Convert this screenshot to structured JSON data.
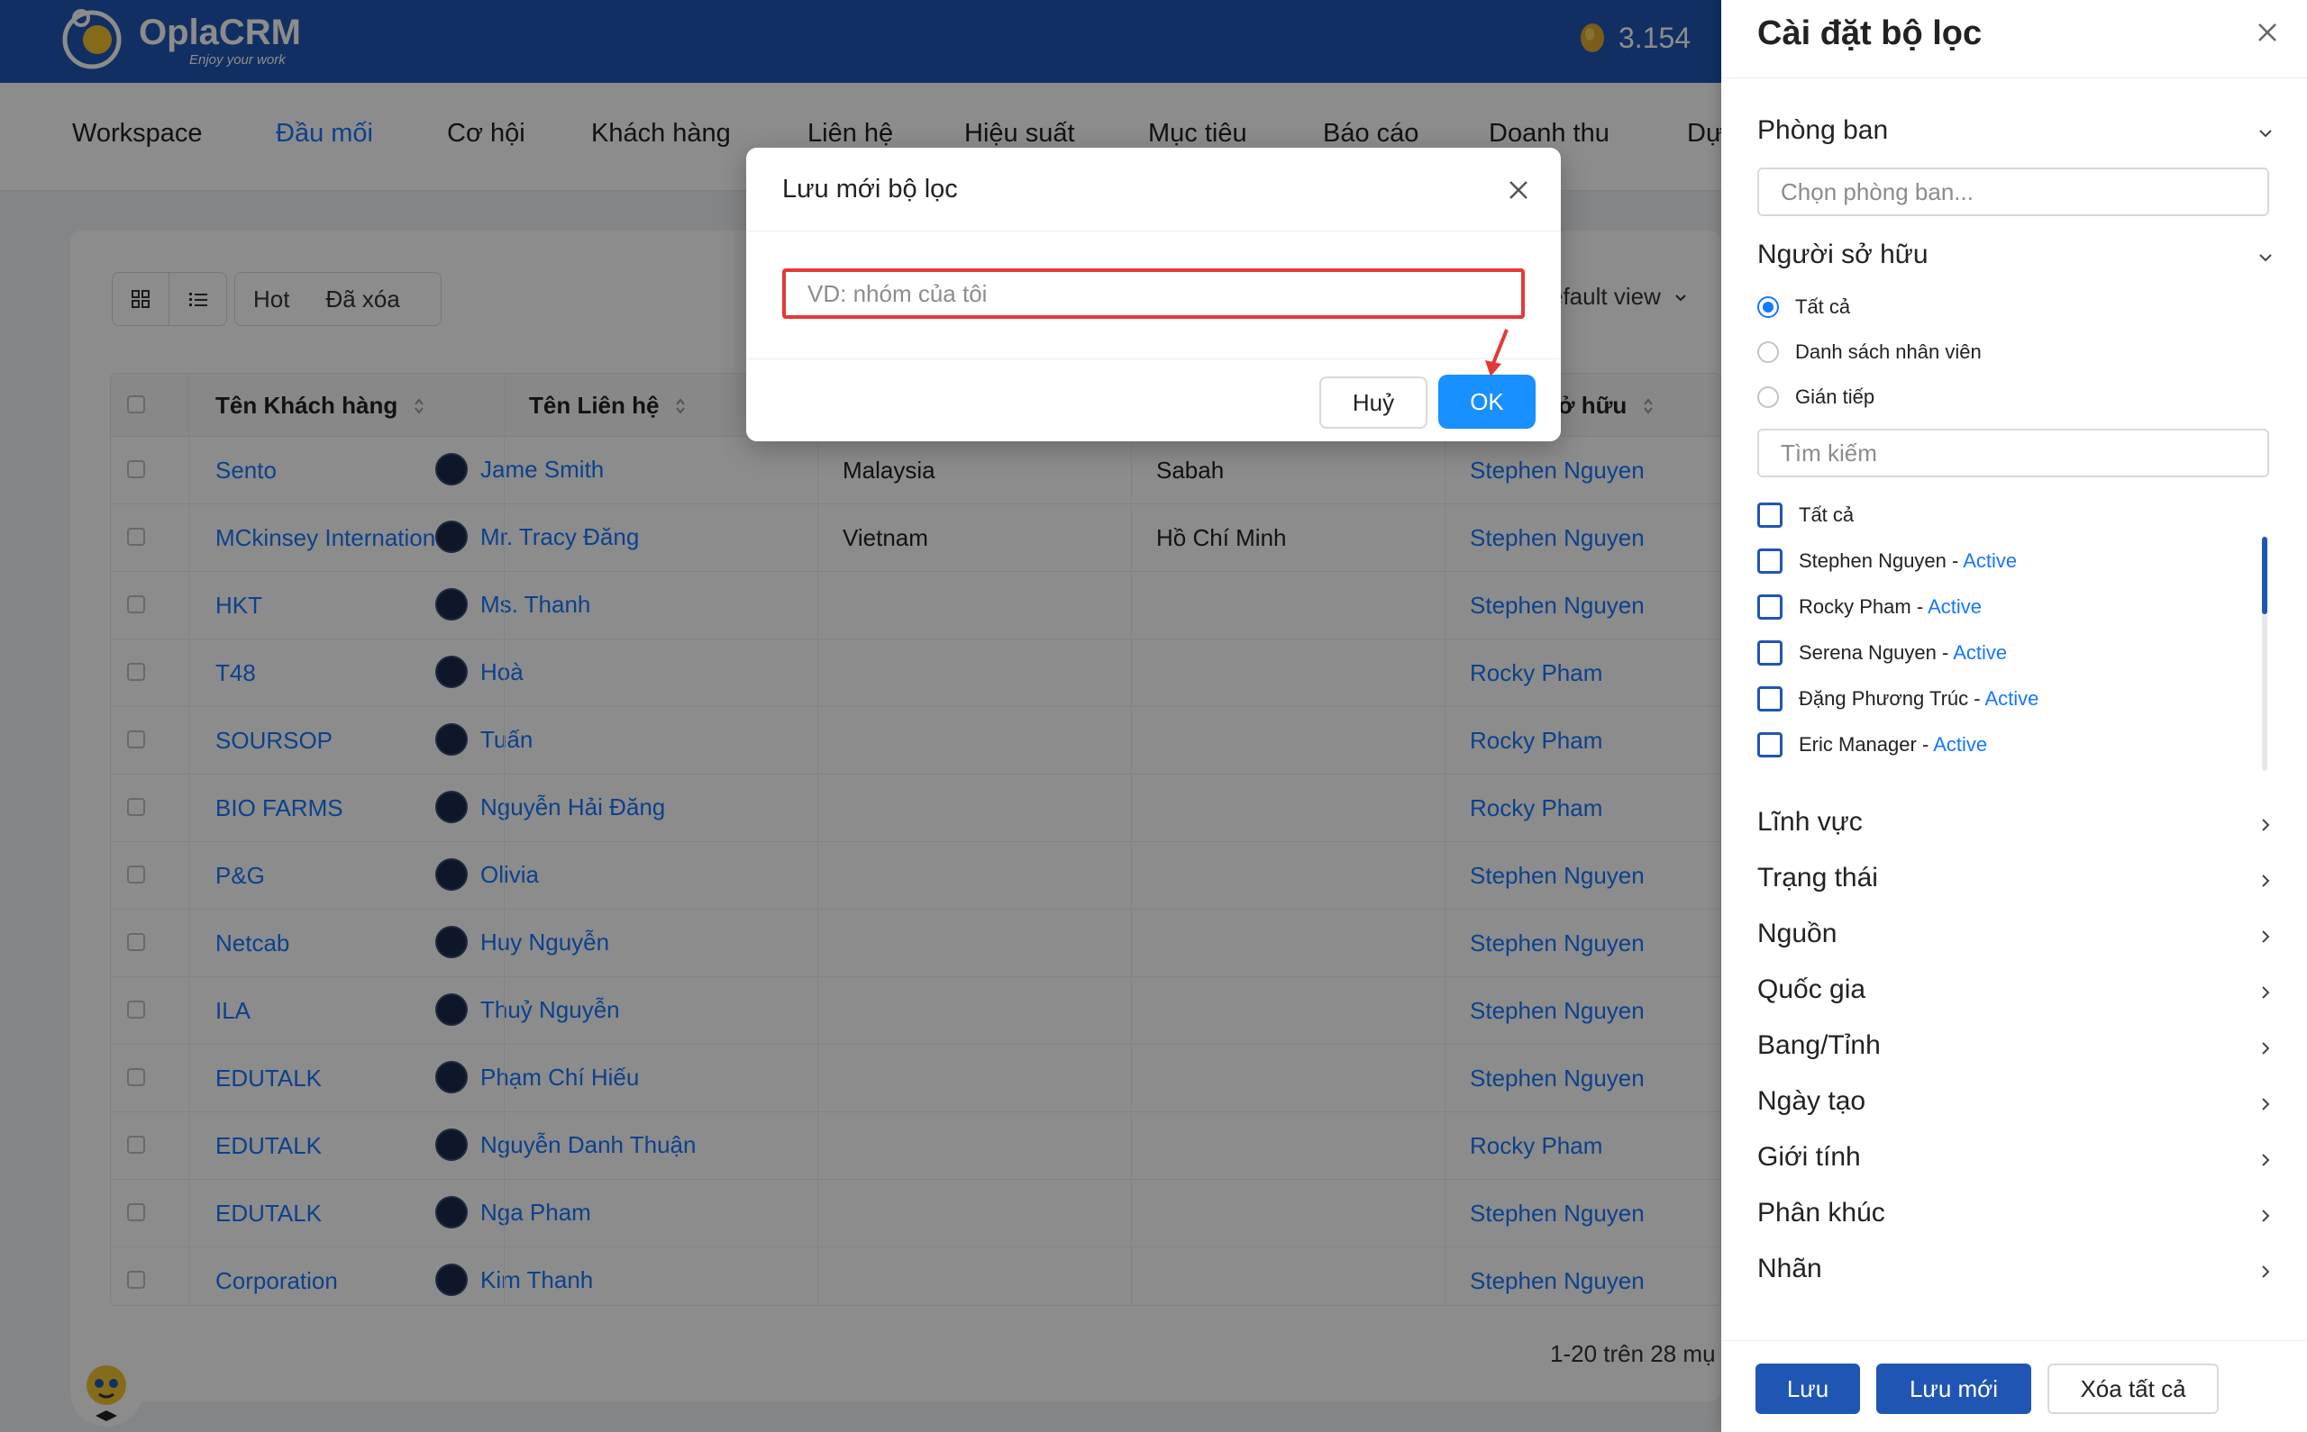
{
  "app": {
    "name": "OplaCRM",
    "tagline": "Enjoy your work",
    "coins": "3.154"
  },
  "nav": [
    "Workspace",
    "Đầu mối",
    "Cơ hội",
    "Khách hàng",
    "Liên hệ",
    "Hiệu suất",
    "Mục tiêu",
    "Báo cáo",
    "Doanh thu",
    "Dự"
  ],
  "nav_active": "Đầu mối",
  "toolbar": {
    "tabs": [
      "Hot",
      "Đã xóa"
    ],
    "view": "efault view"
  },
  "table": {
    "headers": [
      "Tên Khách hàng",
      "Tên Liên hệ",
      "ở hữu"
    ],
    "rows": [
      {
        "company": "Sento",
        "contact": "Jame Smith",
        "country": "Malaysia",
        "state": "Sabah",
        "owner": "Stephen Nguyen"
      },
      {
        "company": "MCkinsey International",
        "contact": "Mr. Tracy Đăng",
        "country": "Vietnam",
        "state": "Hồ Chí Minh",
        "owner": "Stephen Nguyen"
      },
      {
        "company": "HKT",
        "contact": "Ms. Thanh",
        "country": "",
        "state": "",
        "owner": "Stephen Nguyen"
      },
      {
        "company": "T48",
        "contact": "Hoà",
        "country": "",
        "state": "",
        "owner": "Rocky Pham"
      },
      {
        "company": "SOURSOP",
        "contact": "Tuấn",
        "country": "",
        "state": "",
        "owner": "Rocky Pham"
      },
      {
        "company": "BIO FARMS",
        "contact": "Nguyễn Hải Đăng",
        "country": "",
        "state": "",
        "owner": "Rocky Pham"
      },
      {
        "company": "P&G",
        "contact": "Olivia",
        "country": "",
        "state": "",
        "owner": "Stephen Nguyen"
      },
      {
        "company": "Netcab",
        "contact": "Huy Nguyễn",
        "country": "",
        "state": "",
        "owner": "Stephen Nguyen"
      },
      {
        "company": "ILA",
        "contact": "Thuỷ Nguyễn",
        "country": "",
        "state": "",
        "owner": "Stephen Nguyen"
      },
      {
        "company": "EDUTALK",
        "contact": "Phạm Chí Hiếu",
        "country": "",
        "state": "",
        "owner": "Stephen Nguyen"
      },
      {
        "company": "EDUTALK",
        "contact": "Nguyễn Danh Thuận",
        "country": "",
        "state": "",
        "owner": "Rocky Pham"
      },
      {
        "company": "EDUTALK",
        "contact": "Nga Pham",
        "country": "",
        "state": "",
        "owner": "Stephen Nguyen"
      },
      {
        "company": "Corporation",
        "contact": "Kim Thanh",
        "country": "",
        "state": "",
        "owner": "Stephen Nguyen"
      }
    ],
    "pagination": "1-20 trên 28 mụ"
  },
  "modal": {
    "title": "Lưu mới bộ lọc",
    "input_placeholder": "VD: nhóm của tôi",
    "input_value": "",
    "cancel": "Huỷ",
    "ok": "OK"
  },
  "panel": {
    "title": "Cài đặt bộ lọc",
    "department": {
      "title": "Phòng ban",
      "placeholder": "Chọn phòng ban..."
    },
    "owner": {
      "title": "Người sở hữu",
      "radios": [
        "Tất cả",
        "Danh sách nhân viên",
        "Gián tiếp"
      ],
      "selected": "Tất cả",
      "search_placeholder": "Tìm kiếm",
      "users": [
        {
          "name": "Tất cả",
          "status": ""
        },
        {
          "name": "Stephen Nguyen",
          "status": "Active"
        },
        {
          "name": "Rocky Pham",
          "status": "Active"
        },
        {
          "name": "Serena Nguyen",
          "status": "Active"
        },
        {
          "name": "Đặng Phương Trúc",
          "status": "Active"
        },
        {
          "name": "Eric Manager",
          "status": "Active"
        }
      ]
    },
    "sections": [
      "Lĩnh vực",
      "Trạng thái",
      "Nguồn",
      "Quốc gia",
      "Bang/Tỉnh",
      "Ngày tạo",
      "Giới tính",
      "Phân khúc",
      "Nhãn"
    ],
    "buttons": {
      "save": "Lưu",
      "save_new": "Lưu mới",
      "clear_all": "Xóa tất cả"
    }
  },
  "colors": {
    "brand": "#1f56b3",
    "link": "#1677ff",
    "ok_button": "#1890ff",
    "highlight": "#e53935"
  }
}
